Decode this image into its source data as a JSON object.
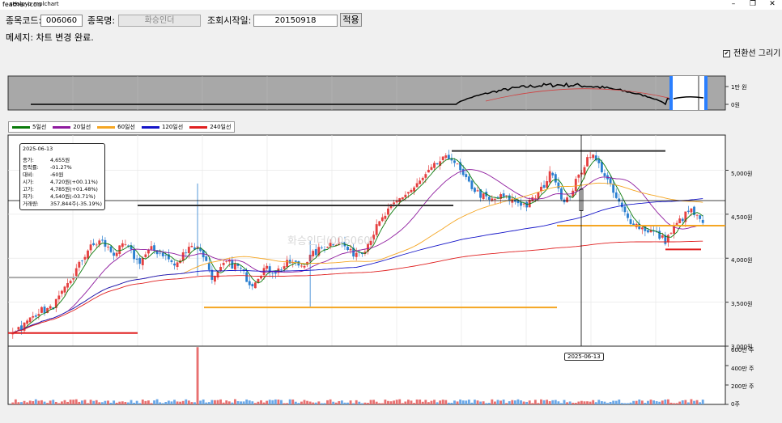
{
  "window": {
    "title": "seolpyo mplchart",
    "icon": "feather-icon",
    "minimize": "–",
    "restore": "❐",
    "close": "✕"
  },
  "form": {
    "code_label": "종목코드:",
    "code_value": "006060",
    "name_label": "종목명:",
    "name_value": "화승인더",
    "start_label": "조회시작일:",
    "start_value": "20150918",
    "apply_label": "적용"
  },
  "message": "메세지: 차트 변경 완료.",
  "toggle_label": "전환선 그리기",
  "toggle_checked": true,
  "legend": [
    {
      "label": "5일선",
      "color": "#0a7a0a"
    },
    {
      "label": "20일선",
      "color": "#8e1a9e"
    },
    {
      "label": "60일선",
      "color": "#f5a623"
    },
    {
      "label": "120일선",
      "color": "#1414c8"
    },
    {
      "label": "240일선",
      "color": "#e02020"
    }
  ],
  "info": {
    "date": "2025-06-13",
    "rows": [
      {
        "k": "종가:",
        "v": "4,655원"
      },
      {
        "k": "등락률:",
        "v": "-01.27%"
      },
      {
        "k": "대비:",
        "v": "-60원"
      },
      {
        "k": "시가:",
        "v": "4,720원(+00.11%)"
      },
      {
        "k": "고가:",
        "v": "4,785원(+01.48%)"
      },
      {
        "k": "저가:",
        "v": "4,540원(-03.71%)"
      },
      {
        "k": "거래량:",
        "v": "357,844주(-35.19%)"
      }
    ]
  },
  "watermark": "화승인더(006060)",
  "crosshair_date": "2025-06-13",
  "overview_ticks": [
    "1만 원",
    "0원"
  ],
  "price_ticks": [
    "5,000원",
    "4,500원",
    "4,000원",
    "3,500원",
    "3,000원"
  ],
  "volume_ticks": [
    "600만 주",
    "400만 주",
    "200만 주",
    "0주"
  ],
  "chart_data": {
    "type": "candlestick",
    "title": "화승인더(006060)",
    "y_range_won": [
      3000,
      5400
    ],
    "volume_range_shares": [
      0,
      6000000
    ],
    "price_ticks": [
      3000,
      3500,
      4000,
      4500,
      5000
    ],
    "volume_ticks": [
      0,
      2000000,
      4000000,
      6000000
    ],
    "close_path": [
      3180,
      3250,
      3400,
      3420,
      3600,
      3850,
      4100,
      4200,
      4050,
      4150,
      3950,
      4100,
      4050,
      3900,
      4150,
      4100,
      3750,
      3950,
      3900,
      3700,
      3880,
      3850,
      3950,
      3920,
      4050,
      4150,
      4200,
      4050,
      4100,
      4350,
      4550,
      4700,
      4800,
      4950,
      5100,
      5150,
      4900,
      4750,
      4650,
      4700,
      4650,
      4600,
      4750,
      5000,
      4600,
      4900,
      5200,
      5000,
      4700,
      4450,
      4350,
      4300,
      4200,
      4400,
      4550,
      4380
    ],
    "crosshair_price_won": 4655,
    "moving_averages": [
      "5일선",
      "20일선",
      "60일선",
      "120일선",
      "240일선"
    ],
    "grid": true
  }
}
